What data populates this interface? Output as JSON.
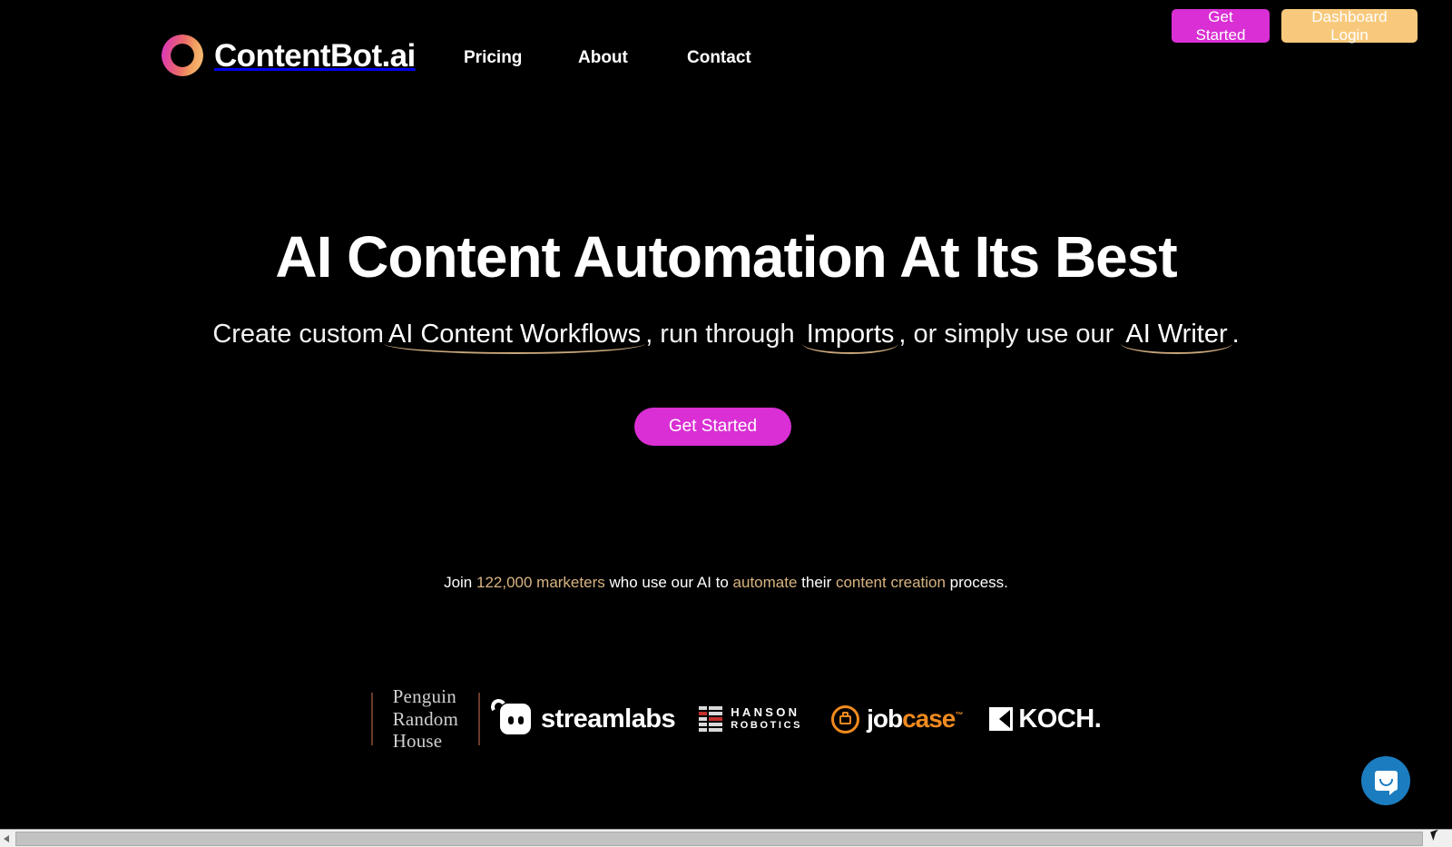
{
  "brand": {
    "name": "ContentBot.ai",
    "logo_icon": "gradient-ring-icon",
    "gradient_start": "#d836d0",
    "gradient_end": "#f7c27c"
  },
  "nav": {
    "links": [
      {
        "label": "Pricing"
      },
      {
        "label": "About"
      },
      {
        "label": "Contact"
      }
    ],
    "buttons": {
      "get_started": {
        "label": "Get Started",
        "color": "#d92fd4"
      },
      "dashboard_login": {
        "label": "Dashboard Login",
        "color": "#f8c97c"
      }
    }
  },
  "hero": {
    "title": "AI Content Automation At Its Best",
    "subtitle": {
      "part1": "Create custom",
      "link1": "AI Content Workflows",
      "part2": ", run through ",
      "link2": "Imports",
      "part3": ", or simply use our ",
      "link3": "AI Writer",
      "part4": ".",
      "underline_color": "#c8a77a"
    },
    "cta": {
      "label": "Get Started",
      "color": "#d92fd4"
    }
  },
  "social_proof": {
    "prefix": "Join ",
    "count": "122,000 marketers",
    "middle": " who use our AI to ",
    "highlight1": "automate",
    "middle2": " their ",
    "highlight2": "content creation",
    "suffix": " process.",
    "highlight_color": "#d8b481"
  },
  "logos": {
    "penguin": {
      "line1": "Penguin",
      "line2": "Random",
      "line3": "House"
    },
    "streamlabs": {
      "name": "streamlabs",
      "icon": "streamlabs-mark-icon"
    },
    "hanson": {
      "line1": "HANSON",
      "line2": "ROBOTICS",
      "icon": "hanson-bars-icon"
    },
    "jobcase": {
      "part_white": "job",
      "part_orange": "case",
      "tm": "™",
      "icon": "briefcase-circle-icon"
    },
    "koch": {
      "name": "KOCH.",
      "icon": "koch-mark-icon"
    }
  },
  "chat": {
    "label": "Open Intercom Messenger",
    "icon": "chat-bubble-icon",
    "color": "#1c7cc0"
  },
  "scrollbar": {
    "orientation": "horizontal",
    "thumb_percent": "98"
  }
}
